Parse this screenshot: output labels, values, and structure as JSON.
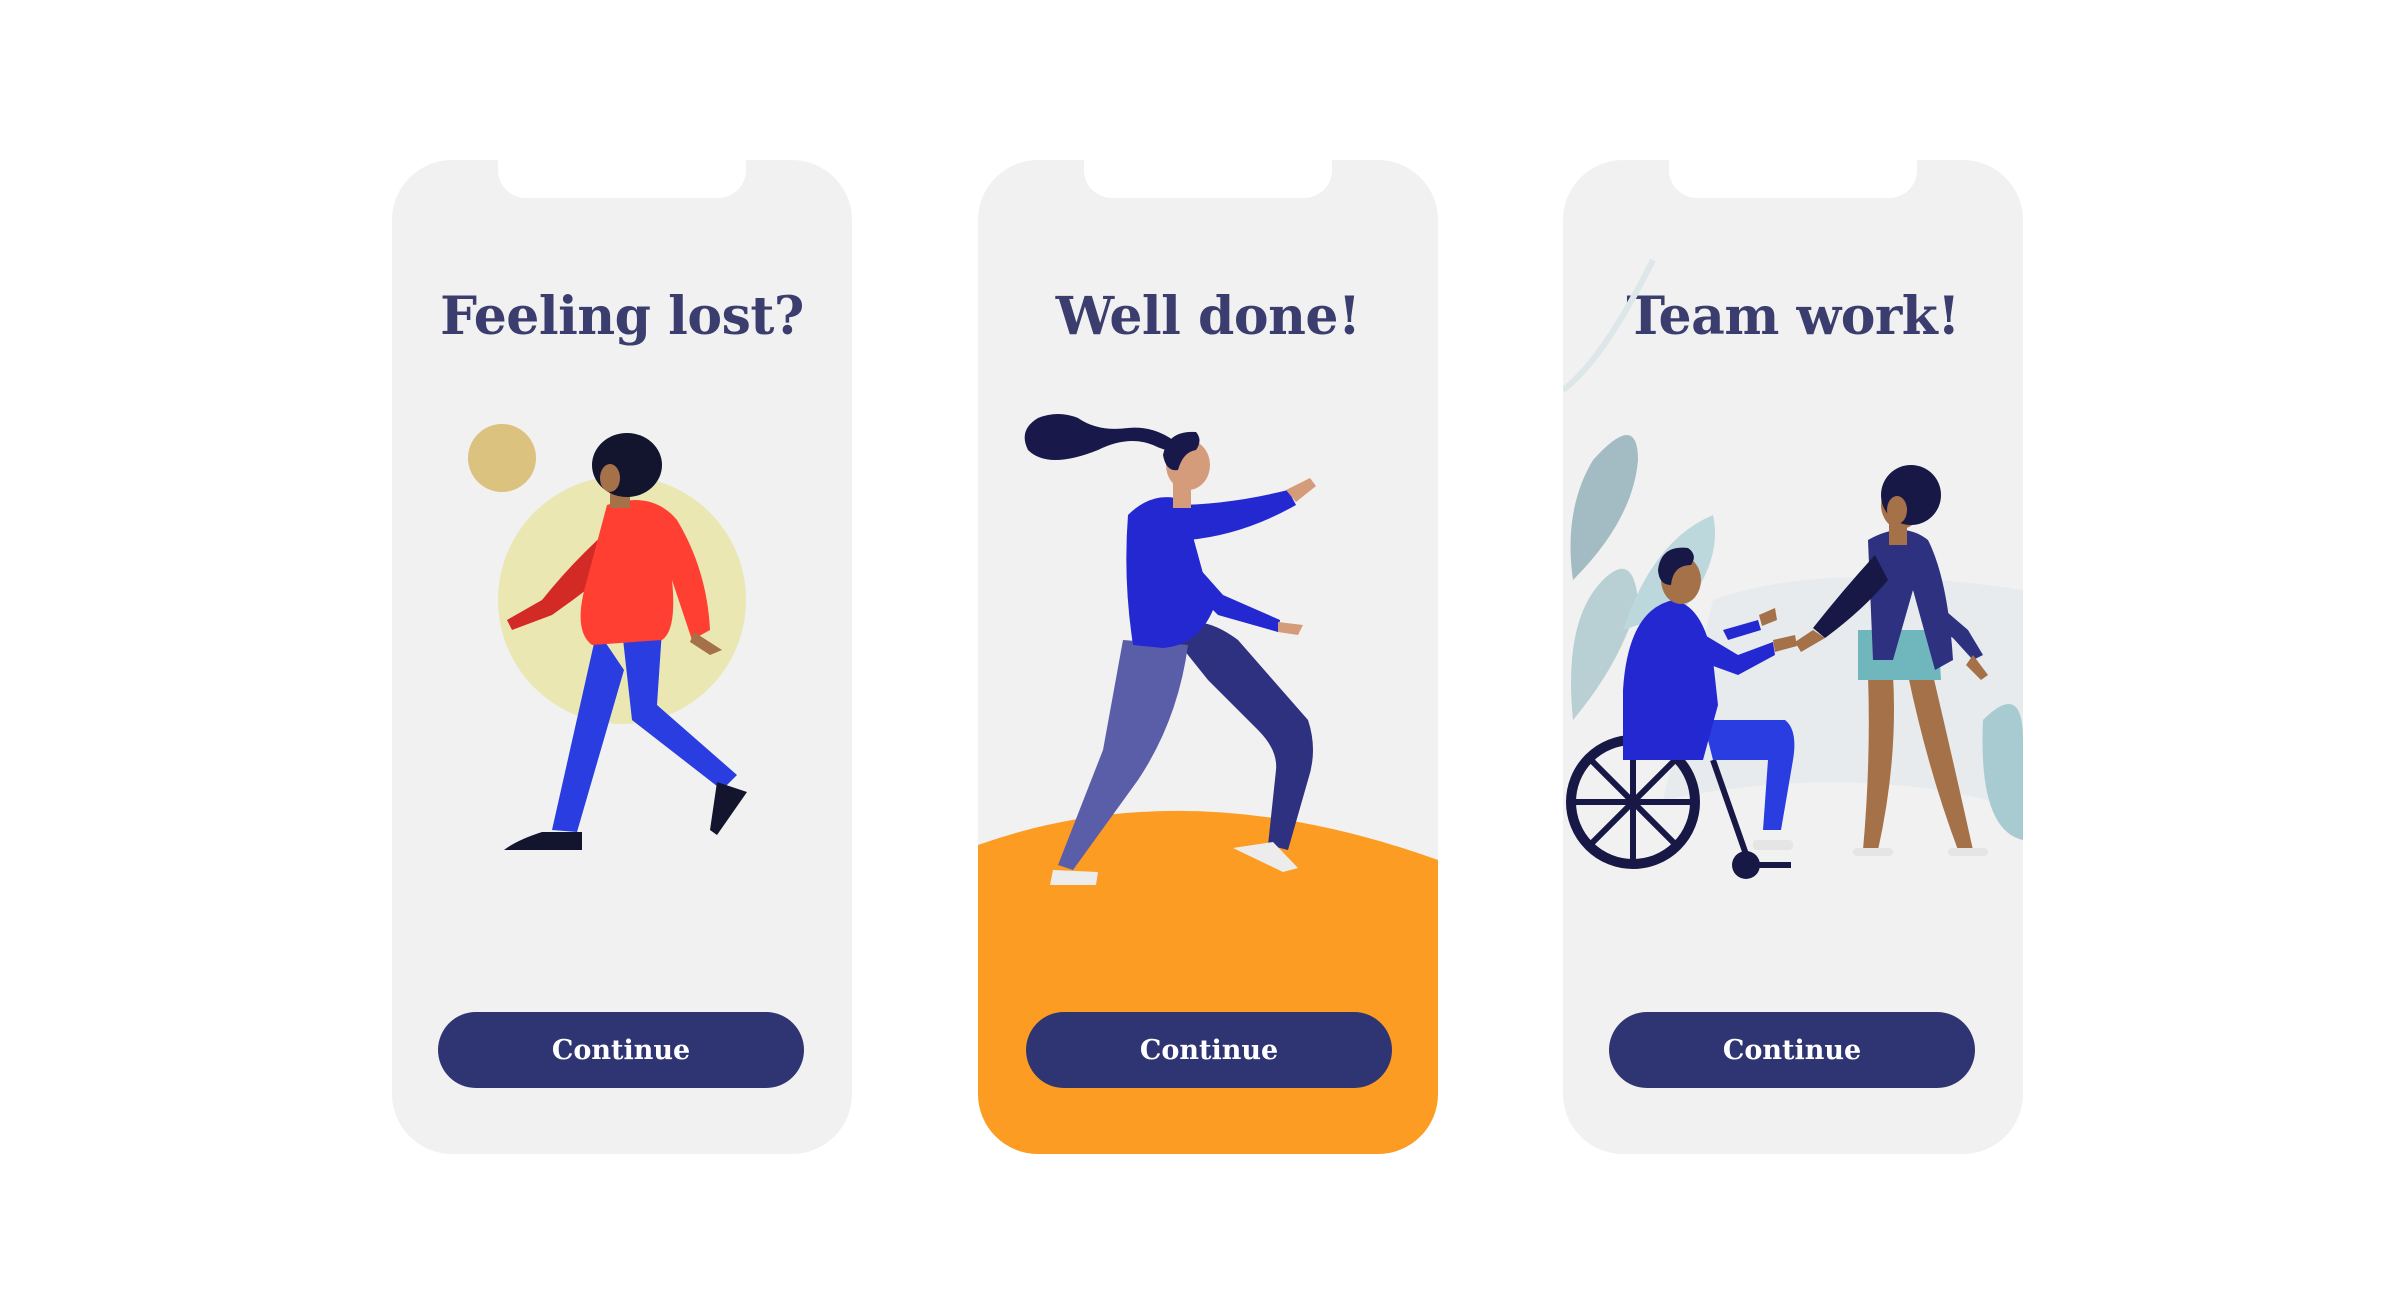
{
  "screens": [
    {
      "title": "Feeling lost?",
      "button_label": "Continue",
      "illustration": "person-walking-illustration"
    },
    {
      "title": "Well done!",
      "button_label": "Continue",
      "illustration": "person-running-illustration"
    },
    {
      "title": "Team work!",
      "button_label": "Continue",
      "illustration": "teamwork-wheelchair-handshake-illustration"
    }
  ],
  "colors": {
    "screen_bg": "#f1f1f1",
    "title_text": "#3b3d6e",
    "button_bg": "#2f3473",
    "button_text": "#ffffff",
    "accent_orange": "#fd9c23"
  }
}
